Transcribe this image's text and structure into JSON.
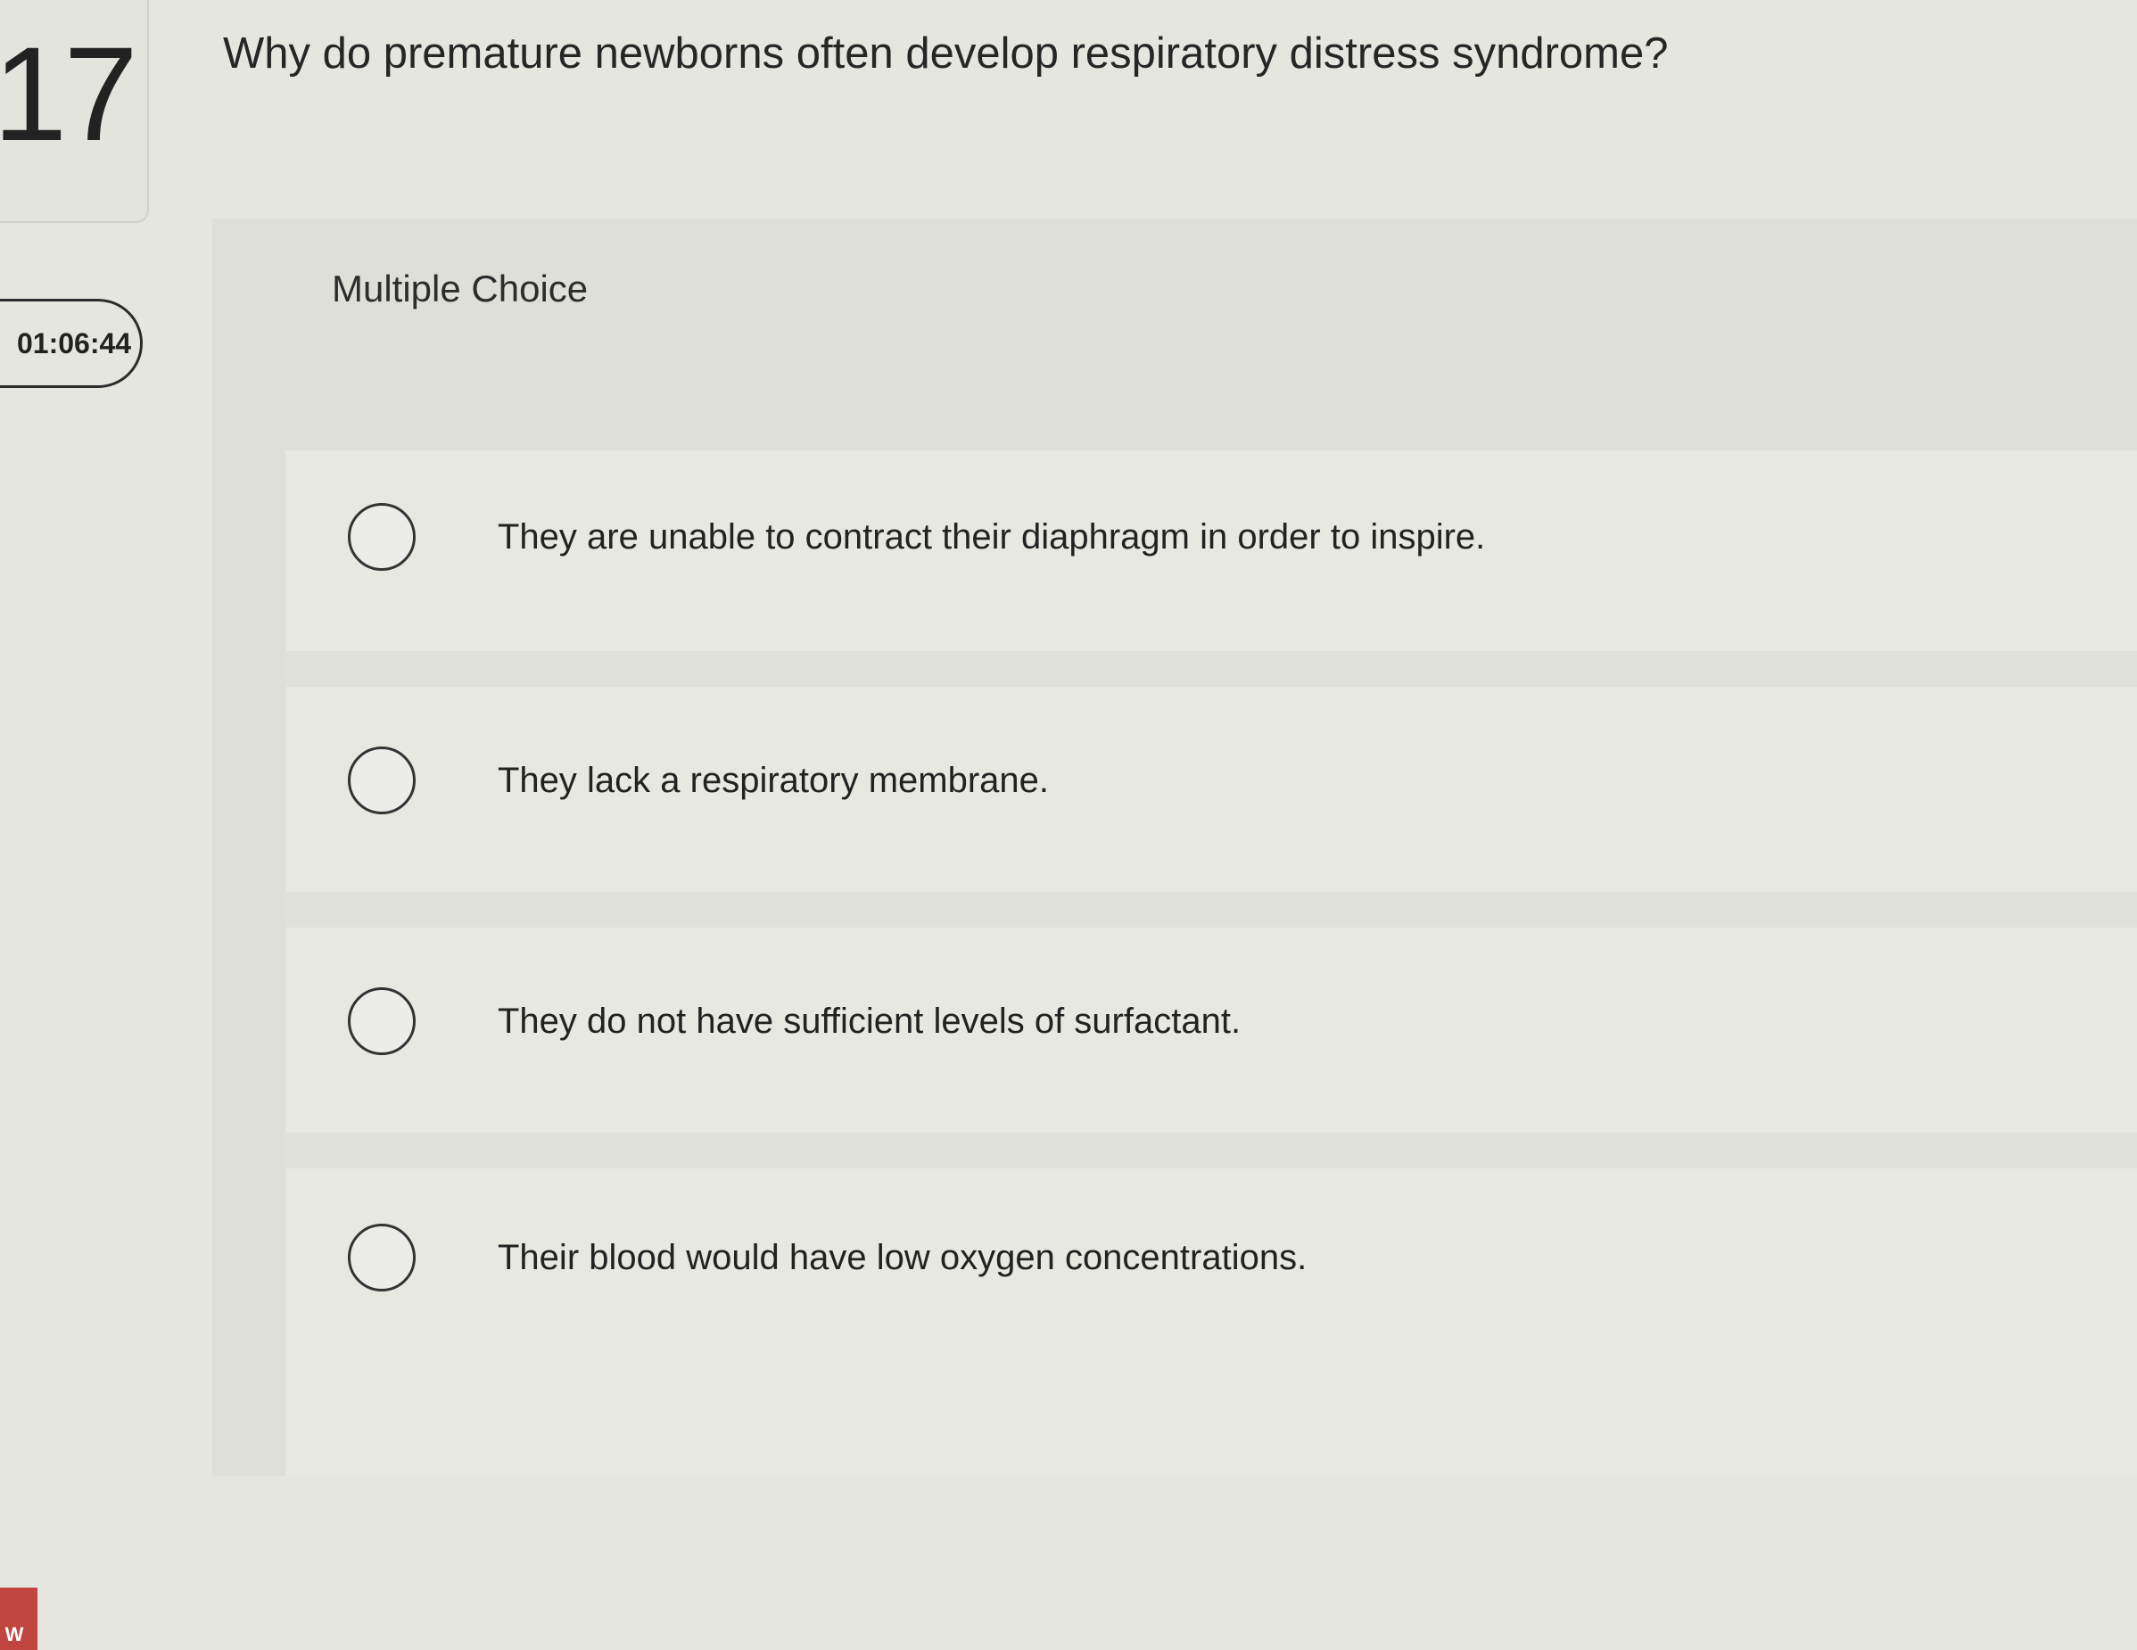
{
  "question_number": "17",
  "timer": "01:06:44",
  "question": "Why do premature newborns often develop respiratory distress syndrome?",
  "type_label": "Multiple Choice",
  "options": [
    {
      "label": "They are unable to contract their diaphragm in order to inspire.",
      "selected": false
    },
    {
      "label": "They lack a respiratory membrane.",
      "selected": false
    },
    {
      "label": "They do not have sufficient levels of surfactant.",
      "selected": false
    },
    {
      "label": "Their blood would have low oxygen concentrations.",
      "selected": false
    }
  ],
  "corner_badge": "W"
}
